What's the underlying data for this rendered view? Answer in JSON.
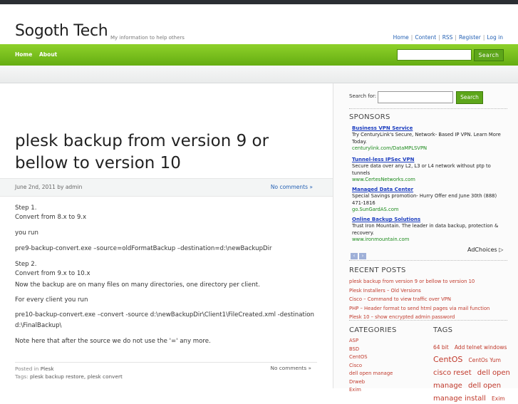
{
  "header": {
    "site_title": "Sogoth Tech",
    "tagline": "My information to help others",
    "links": [
      "Home",
      "Content",
      "RSS",
      "Register",
      "Log in"
    ]
  },
  "nav": {
    "items": [
      "Home",
      "About"
    ],
    "search_button": "Search"
  },
  "post": {
    "title": "plesk backup from version 9 or bellow to version 10",
    "date": "June 2nd, 2011 by admin",
    "comments": "No comments »",
    "paragraphs": [
      "Step 1.",
      "Convert from 8.x to 9.x",
      "you run",
      "pre9-backup-convert.exe –source=oldFormatBackup –destination=d:\\newBackupDir",
      "Step 2.",
      "Convert from 9.x to 10.x",
      "Now the backup are on many files on many directories, one directory per client.",
      "For every client you run",
      "pre10-backup-convert.exe –convert -source d:\\newBackupDir\\Client1\\FileCreated.xml -destination",
      "d:\\FinalBackup\\",
      "Note here that after the source we do not use the '=' any more."
    ],
    "posted_in_label": "Posted in",
    "posted_in": "Plesk",
    "tags_label": "Tags:",
    "tags": "plesk backup restore, plesk convert",
    "footer_comments": "No comments »"
  },
  "sidebar": {
    "search_label": "Search for:",
    "search_button": "Search",
    "sponsors_heading": "SPONSORS",
    "ads": [
      {
        "title": "Business VPN Service",
        "desc": "Try CenturyLink's Secure, Network- Based IP VPN. Learn More Today.",
        "url": "centurylink.com/DataMPLSVPN"
      },
      {
        "title": "Tunnel-less IPSec VPN",
        "desc": "Secure data over any L2, L3 or L4 network without ptp to tunnels",
        "url": "www.CertesNetworks.com"
      },
      {
        "title": "Managed Data Center",
        "desc": "Special Savings promotion- Hurry Offer end June 30th (888) 471-1816",
        "url": "go.SunGardAS.com"
      },
      {
        "title": "Online Backup Solutions",
        "desc": "Trust Iron Mountain. The leader in data backup, protection & recovery.",
        "url": "www.ironmountain.com"
      }
    ],
    "adchoices": "AdChoices ▷",
    "recent_heading": "RECENT POSTS",
    "recent": [
      "plesk backup from version 9 or bellow to version 10",
      "Plesk Installers – Old Versions",
      "Cisco – Command to view traffic over VPN",
      "PHP – Header format to send html pages via mail function",
      "Plesk 10 – show encrypted admin password"
    ],
    "categories_heading": "CATEGORIES",
    "categories": [
      "ASP",
      "BSD",
      "CentOS",
      "Cisco",
      "dell open manage",
      "Drweb",
      "Exim"
    ],
    "tags_heading": "TAGS",
    "tags": [
      {
        "t": "64 bit",
        "s": 7.5
      },
      {
        "t": "Add telnet windows",
        "s": 7.5
      },
      {
        "t": "CentOS",
        "s": 11
      },
      {
        "t": "CentOs Yum",
        "s": 7.5
      },
      {
        "t": "cisco reset",
        "s": 10
      },
      {
        "t": "dell open manage",
        "s": 10
      },
      {
        "t": "dell open manage install",
        "s": 10
      },
      {
        "t": "Exim",
        "s": 7.5
      }
    ],
    "accent_link_color": "#c0392b",
    "ad_title_color": "#1a3cbf",
    "ad_url_color": "#1b8a1b"
  }
}
